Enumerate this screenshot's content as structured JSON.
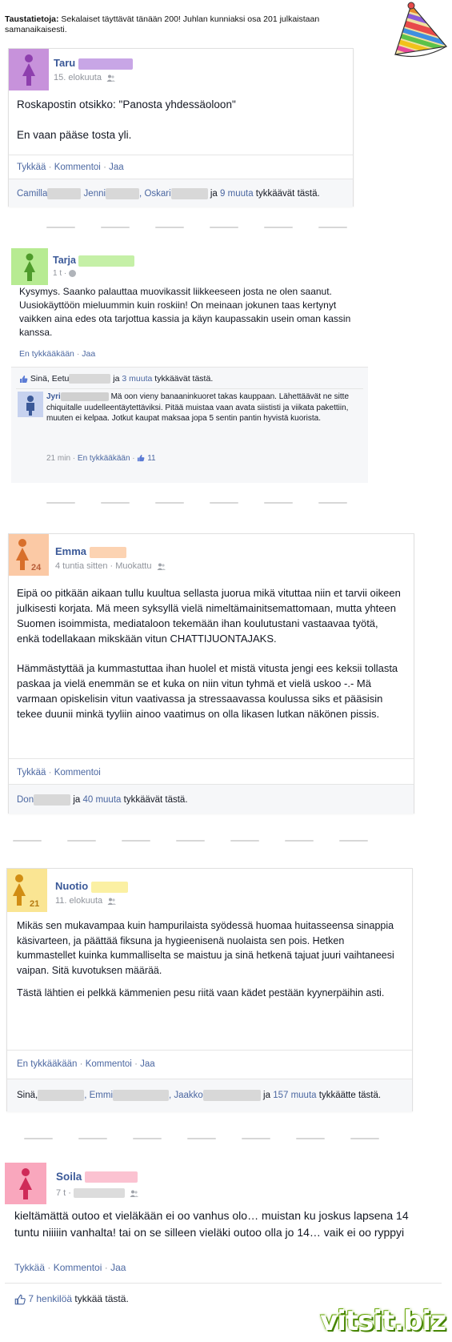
{
  "banner": {
    "label": "Taustatietoja:",
    "text": " Sekalaiset täyttävät tänään 200! Juhlan kunniaksi osa 201 julkaistaan samanaikaisesti."
  },
  "posts": [
    {
      "name": "Taru",
      "meta": "15. elokuuta",
      "body": [
        "Roskapostin otsikko: \"Panosta yhdessäoloon\"",
        "En vaan pääse tosta yli."
      ],
      "actions": [
        "Tykkää",
        "Kommentoi",
        "Jaa"
      ],
      "likes": {
        "names": [
          "Camilla",
          "Jenni",
          "Oskari"
        ],
        "and": "ja",
        "count": "9 muuta",
        "suffix": "tykkäävät tästä."
      },
      "color": "#b56ccf"
    },
    {
      "name": "Tarja",
      "meta": "1 t ·",
      "body": [
        "Kysymys. Saanko palauttaa muovikassit liikkeeseen josta ne olen saanut. Uusiokäyttöön mieluummin kuin roskiin! On meinaan jokunen taas kertynyt vaikken aina edes ota tarjottua kassia ja käyn kaupassakin usein oman kassin kanssa."
      ],
      "actions": [
        "En tykkääkään",
        "Jaa"
      ],
      "likes": {
        "names": [
          "Sinä, Eetu"
        ],
        "and": "ja",
        "count": "3 muuta",
        "suffix": "tykkäävät tästä."
      },
      "comment": {
        "name": "Jyri",
        "text": "Mä oon vieny banaaninkuoret takas kauppaan. Lähettäävät ne sitte chiquitalle uudelleentäytettäviksi. Pitää muistaa vaan avata siististi ja viikata pakettiin, muuten ei kelpaa. Jotkut kaupat maksaa jopa 5 sentin pantin hyvistä kuorista.",
        "time": "21 min",
        "action": "En tykkääkään",
        "likes": "11"
      },
      "color": "#8cd35a"
    },
    {
      "name": "Emma",
      "age": "24",
      "meta": "4 tuntia sitten · Muokattu",
      "body": [
        "Eipä oo pitkään aikaan tullu kuultua sellasta juorua mikä vituttaa niin et tarvii oikeen julkisesti korjata. Mä meen syksyllä vielä nimeltämainitsemattomaan, mutta yhteen Suomen isoimmista, mediataloon tekemään ihan koulutustani vastaavaa työtä, enkä todellakaan mikskään vitun CHATTIJUONTAJAKS.",
        "Hämmästyttää ja kummastuttaa ihan huolel et mistä vitusta jengi ees keksii tollasta paskaa ja vielä enemmän se et kuka on niin vitun tyhmä et vielä uskoo -.- Mä varmaan opiskelisin vitun vaativassa ja stressaavassa koulussa siks et pääsisin tekee duunii minkä tyyliin ainoo vaatimus on olla likasen lutkan näkönen pissis."
      ],
      "actions": [
        "Tykkää",
        "Kommentoi"
      ],
      "likes": {
        "names": [
          "Don"
        ],
        "and": "ja",
        "count": "40 muuta",
        "suffix": "tykkäävät tästä."
      },
      "color": "#f4a05e"
    },
    {
      "name": "Nuotio",
      "age": "21",
      "meta": "11. elokuuta",
      "body": [
        "Mikäs sen mukavampaa kuin hampurilaista syödessä huomaa huitasseensa sinappia käsivarteen, ja päättää fiksuna ja hygieenisenä nuolaista sen pois. Hetken kummastellet kuinka kummalliselta se maistuu ja sinä hetkenä tajuat juuri vaihtaneesi vaipan. Sitä kuvotuksen määrää.",
        "Tästä lähtien ei pelkkä kämmenien pesu riitä vaan kädet pestään kyynerpäihin asti."
      ],
      "actions": [
        "En tykkääkään",
        "Kommentoi",
        "Jaa"
      ],
      "likes": {
        "names": [
          "Sinä,",
          "Emmi",
          "Jaakko"
        ],
        "and": "ja",
        "count": "157 muuta",
        "suffix": "tykkäätte tästä."
      },
      "color": "#f6c642"
    },
    {
      "name": "Soila",
      "meta": "7 t ·",
      "body": [
        "kieltämättä outoo et vieläkään ei oo vanhus olo… muistan ku joskus lapsena 14 tuntu niiiiin vanhalta! tai on se silleen vieläki outoo olla jo 14… vaik ei oo ryppyi"
      ],
      "actions": [
        "Tykkää",
        "Kommentoi",
        "Jaa"
      ],
      "likes": {
        "count": "7 henkilöä",
        "suffix": "tykkää tästä."
      },
      "color": "#e7537a"
    }
  ],
  "watermark": "vitsit.biz"
}
